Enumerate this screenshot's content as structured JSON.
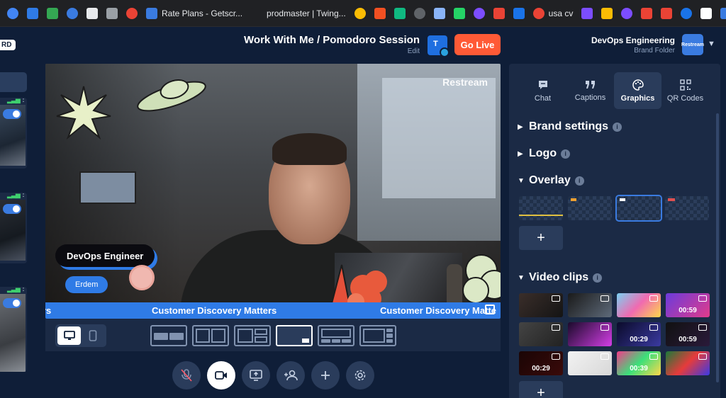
{
  "bookmarks": [
    {
      "label": "",
      "color": "#4285f4"
    },
    {
      "label": "",
      "color": "#2f7be6"
    },
    {
      "label": "",
      "color": "#34a853"
    },
    {
      "label": "",
      "color": "#3a7be0"
    },
    {
      "label": "",
      "color": "#e8eaed"
    },
    {
      "label": "",
      "color": "#9aa0a6"
    },
    {
      "label": "",
      "color": "#ea4335"
    },
    {
      "label": "Rate Plans - Getscr...",
      "color": "#3a7be0"
    },
    {
      "label": "prodmaster | Twing...",
      "color": "#202124"
    },
    {
      "label": "",
      "color": "#fbbc04"
    },
    {
      "label": "",
      "color": "#f25022"
    },
    {
      "label": "",
      "color": "#10b981"
    },
    {
      "label": "",
      "color": "#5f6368"
    },
    {
      "label": "",
      "color": "#8ab4f8"
    },
    {
      "label": "",
      "color": "#25d366"
    },
    {
      "label": "",
      "color": "#7c4dff"
    },
    {
      "label": "",
      "color": "#ea4335"
    },
    {
      "label": "",
      "color": "#1a73e8"
    },
    {
      "label": "usa cv",
      "color": "#ea4335"
    },
    {
      "label": "",
      "color": "#7c4dff"
    },
    {
      "label": "",
      "color": "#fbbc04"
    },
    {
      "label": "",
      "color": "#7c4dff"
    },
    {
      "label": "",
      "color": "#ea4335"
    },
    {
      "label": "",
      "color": "#ea4335"
    },
    {
      "label": "",
      "color": "#1a73e8"
    },
    {
      "label": "",
      "color": "#ffffff"
    },
    {
      "label": "",
      "color": "#3a7be0"
    }
  ],
  "bookmarks_more": "»",
  "header": {
    "badge": "RD",
    "title": "Work With Me / Pomodoro Session",
    "edit": "Edit",
    "dest_letter": "T",
    "go_live": "Go Live",
    "brand_name": "DevOps Engineering",
    "brand_sub": "Brand Folder",
    "brand_logo": "Restream"
  },
  "stage": {
    "watermark": "Restream",
    "name_tag": "DevOps Engineer",
    "name_sub": "Erdem",
    "ticker": [
      "rs",
      "Customer Discovery Matters",
      "Customer Discovery Matte"
    ]
  },
  "panel": {
    "tabs": [
      {
        "label": "Chat",
        "icon": "chat-icon"
      },
      {
        "label": "Captions",
        "icon": "quote-icon"
      },
      {
        "label": "Graphics",
        "icon": "palette-icon"
      },
      {
        "label": "QR Codes",
        "icon": "qr-icon"
      }
    ],
    "sections": {
      "brand": "Brand settings",
      "logo": "Logo",
      "overlay": "Overlay",
      "clips": "Video clips"
    },
    "add": "+",
    "clips": [
      {
        "label": "",
        "bg": "linear-gradient(135deg,#3a2e2a,#141414)"
      },
      {
        "label": "",
        "bg": "linear-gradient(135deg,#1a1a1a,#5e6a7a)"
      },
      {
        "label": "",
        "bg": "linear-gradient(135deg,#7ad1f2,#f06ab0,#ffd84a)"
      },
      {
        "label": "00:59",
        "bg": "linear-gradient(135deg,#6a3bdc,#e13b8a)"
      },
      {
        "label": "",
        "bg": "linear-gradient(135deg,#444,#222)"
      },
      {
        "label": "",
        "bg": "linear-gradient(135deg,#1a0a2a,#d43ee6)"
      },
      {
        "label": "00:29",
        "bg": "linear-gradient(135deg,#0b0b2a,#3a3aa0)"
      },
      {
        "label": "00:59",
        "bg": "linear-gradient(135deg,#111,#2a1a3a)"
      },
      {
        "label": "00:29",
        "bg": "linear-gradient(135deg,#1a0505,#3a0a0a)"
      },
      {
        "label": "",
        "bg": "linear-gradient(135deg,#f2f2f2,#d8d8d8)"
      },
      {
        "label": "00:39",
        "bg": "linear-gradient(135deg,#f23b8a,#3be07a,#ffd84a)"
      },
      {
        "label": "",
        "bg": "linear-gradient(135deg,#1a7a3a,#e63b3b,#3a3ae6)"
      }
    ]
  }
}
